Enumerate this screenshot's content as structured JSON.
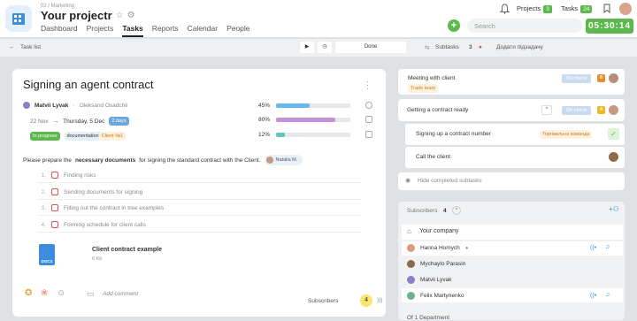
{
  "header": {
    "breadcrumb": "02 / Marketing",
    "project_title": "Your projectr",
    "tabs": [
      "Dashboard",
      "Projects",
      "Tasks",
      "Reports",
      "Calendar",
      "People"
    ],
    "active_tab": "Tasks",
    "projects_label": "Projects",
    "projects_count": "3",
    "tasks_label": "Tasks",
    "tasks_count": "24",
    "search_placeholder": "Search",
    "timer": "05:30:14"
  },
  "toolbar": {
    "task_list": "Task list",
    "done_label": "Done",
    "subtasks_label": "Subtasks",
    "subtasks_count": "3",
    "add_subtask": "Додати підзадачу"
  },
  "task": {
    "title": "Signing an agent contract",
    "assignee": "Matvii Lyvak",
    "owner": "Oleksand Osadchii",
    "date_from": "22 Nov",
    "date_to": "Thursday, 5 Dec",
    "duration": "2 days",
    "status": "In progress",
    "tag": "documentation",
    "client": "Client №1",
    "progress": [
      {
        "pct": "45%",
        "value": 45,
        "color": "#69b8f0"
      },
      {
        "pct": "80%",
        "value": 80,
        "color": "#c490d8"
      },
      {
        "pct": "12%",
        "value": 12,
        "color": "#5cc6c0"
      }
    ],
    "desc_pre": "Please prepare the",
    "desc_bold": "necessary documents",
    "desc_post": "for signing the standard contract with the Client.",
    "mention": "Natalia M.",
    "checklist": [
      {
        "n": "1.",
        "text": "Finding risks"
      },
      {
        "n": "2.",
        "text": "Sending documents for signing"
      },
      {
        "n": "3.",
        "text": "Filling out the contract in tree examples"
      },
      {
        "n": "4.",
        "text": "Forming schedule for client calls"
      }
    ],
    "file_name": "Client contract example",
    "file_size": "6 Kb",
    "file_ext": "DOCX",
    "add_comment": "Add comment",
    "subscribers_label": "Subscribers",
    "subscribers_count": "4"
  },
  "right": {
    "items": [
      {
        "title": "Meeting with client",
        "tag": "Trade team",
        "status": "On check",
        "num": "8",
        "num_color": "#f08a24"
      },
      {
        "title": "Getting a contract ready",
        "status": "On check",
        "num": "4",
        "num_color": "#f0b824"
      }
    ],
    "subitems": [
      {
        "title": "Signing up a contract number",
        "tag": "Торгівельна команда"
      },
      {
        "title": "Call the client"
      }
    ],
    "hide_completed": "Hide completed subtasks",
    "subscribers_label": "Subscribers",
    "subscribers_count": "4",
    "company": "Your company",
    "members": [
      {
        "name": "Hanna Homych",
        "color": "#d7a07c"
      },
      {
        "name": "Mychaylo Parasin",
        "color": "#8c6a4a"
      },
      {
        "name": "Matvii Lyvak",
        "color": "#8b7fc9"
      },
      {
        "name": "Felix Martynenko",
        "color": "#6fb38e"
      }
    ],
    "department": "Of 1 Department"
  }
}
